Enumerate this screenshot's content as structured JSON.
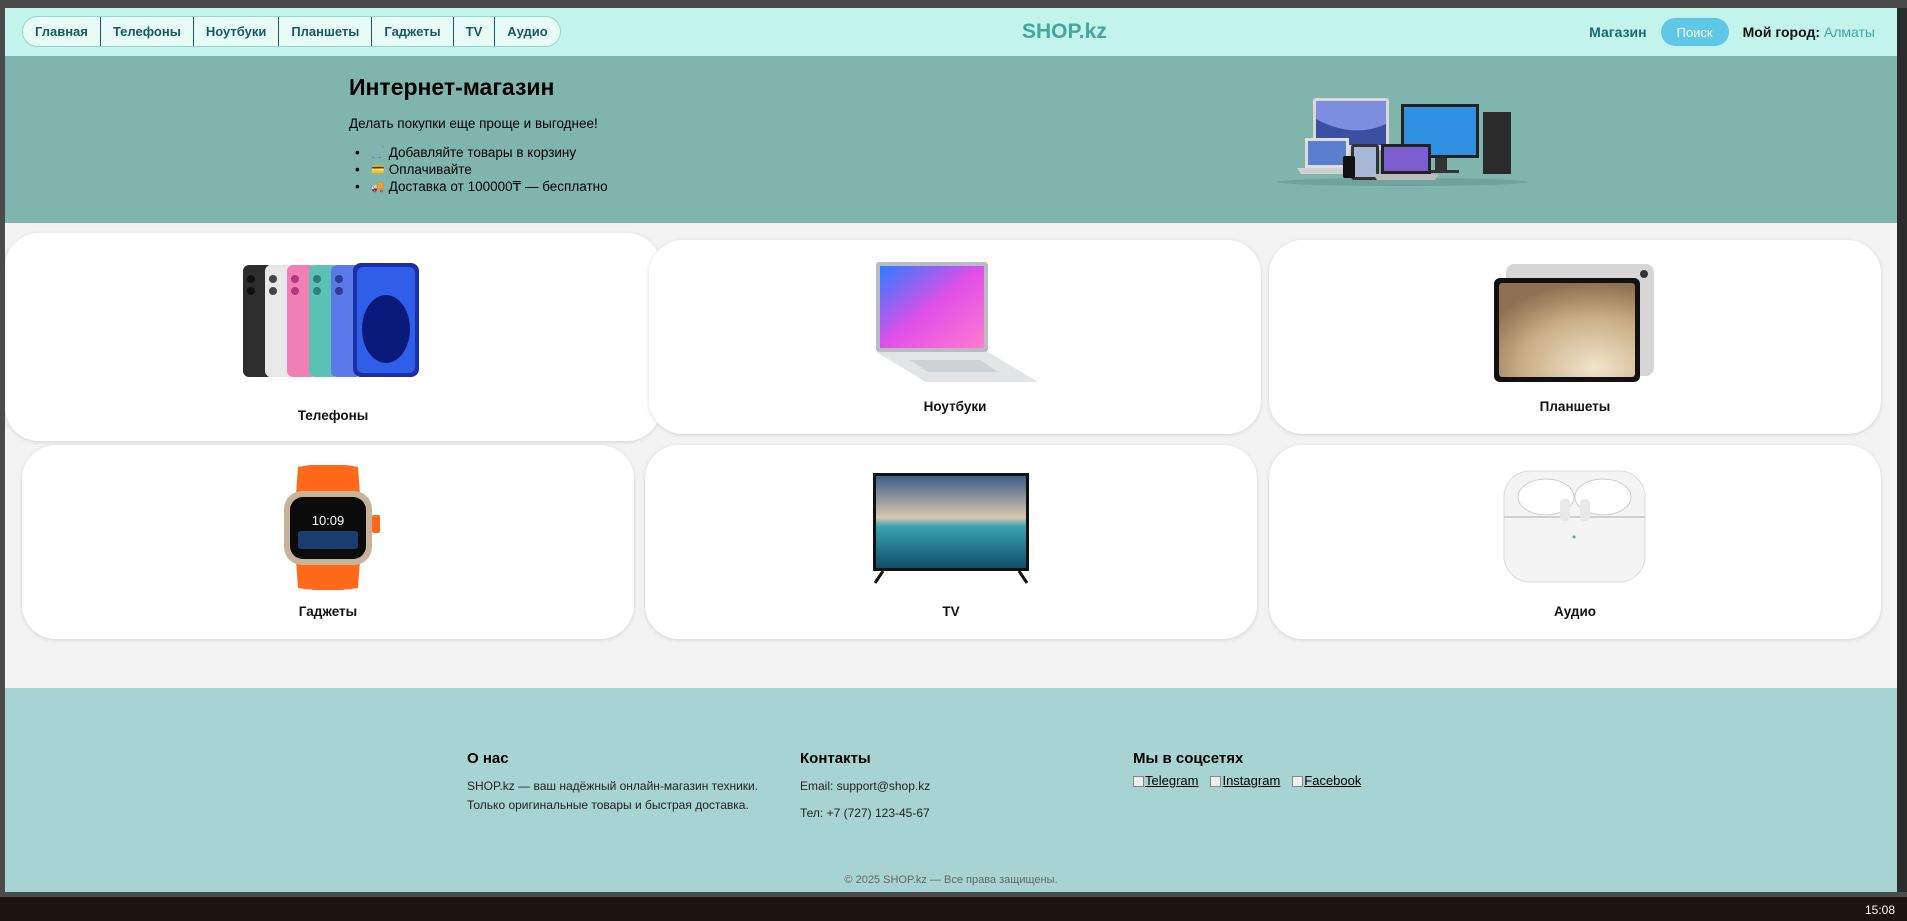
{
  "nav": {
    "items": [
      {
        "label": "Главная"
      },
      {
        "label": "Телефоны"
      },
      {
        "label": "Ноутбуки"
      },
      {
        "label": "Планшеты"
      },
      {
        "label": "Гаджеты"
      },
      {
        "label": "TV"
      },
      {
        "label": "Аудио"
      }
    ],
    "logo": "SHOP.kz",
    "shop_label": "Магазин",
    "search_label": "Поиск",
    "city_label": "Мой город:",
    "city_value": "Алматы"
  },
  "hero": {
    "title": "Интернет-магазин",
    "subtitle": "Делать покупки еще проще и выгоднее!",
    "bullets": [
      {
        "icon": "🛒",
        "text": "Добавляйте товары в корзину"
      },
      {
        "icon": "💳",
        "text": "Оплачивайте"
      },
      {
        "icon": "🚚",
        "text": "Доставка от 100000₸ — бесплатно"
      }
    ]
  },
  "categories": [
    {
      "label": "Телефоны"
    },
    {
      "label": "Ноутбуки"
    },
    {
      "label": "Планшеты"
    },
    {
      "label": "Гаджеты"
    },
    {
      "label": "TV"
    },
    {
      "label": "Аудио"
    }
  ],
  "footer": {
    "about_title": "О нас",
    "about_line1": "SHOP.kz — ваш надёжный онлайн-магазин техники.",
    "about_line2": "Только оригинальные товары и быстрая доставка.",
    "contacts_title": "Контакты",
    "email": "Email: support@shop.kz",
    "phone": "Тел: +7 (727) 123-45-67",
    "social_title": "Мы в соцсетях",
    "social": [
      "Telegram",
      "Instagram",
      "Facebook"
    ],
    "copyright": "© 2025 SHOP.kz — Все права защищены."
  },
  "taskbar": {
    "clock": "15:08"
  }
}
